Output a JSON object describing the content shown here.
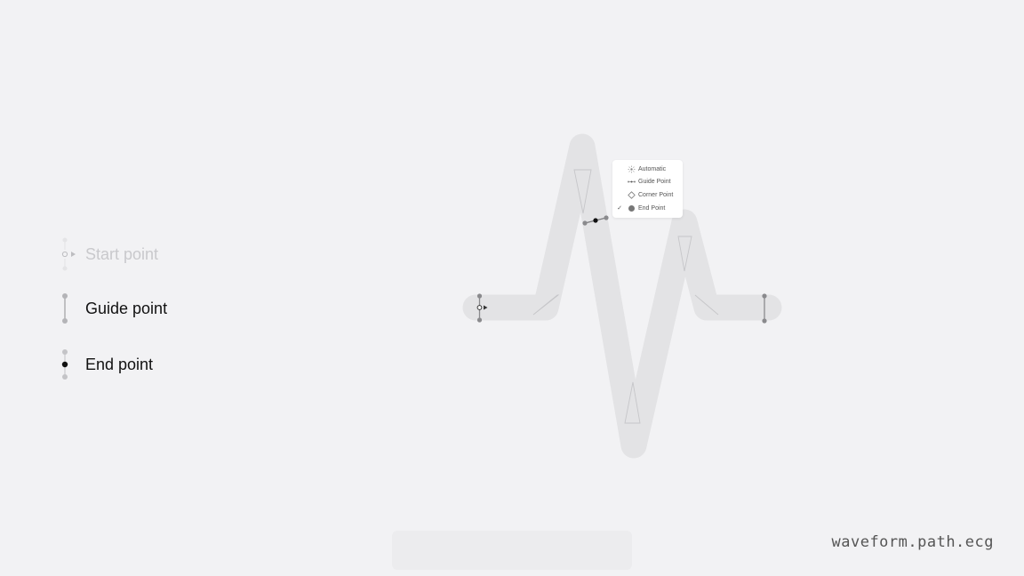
{
  "legend": {
    "start_label": "Start point",
    "guide_label": "Guide point",
    "end_label": "End point"
  },
  "point_menu": {
    "items": [
      {
        "label": "Automatic",
        "icon": "automatic-icon",
        "selected": false
      },
      {
        "label": "Guide Point",
        "icon": "guide-point-icon",
        "selected": false
      },
      {
        "label": "Corner Point",
        "icon": "corner-point-icon",
        "selected": false
      },
      {
        "label": "End Point",
        "icon": "end-point-icon",
        "selected": true
      }
    ],
    "check_mark": "✓"
  },
  "symbol_name": "waveform.path.ecg",
  "colors": {
    "background": "#f2f2f4",
    "stroke_fill": "#e3e3e5",
    "handle": "#888888",
    "dim": "#c9c9cc"
  }
}
